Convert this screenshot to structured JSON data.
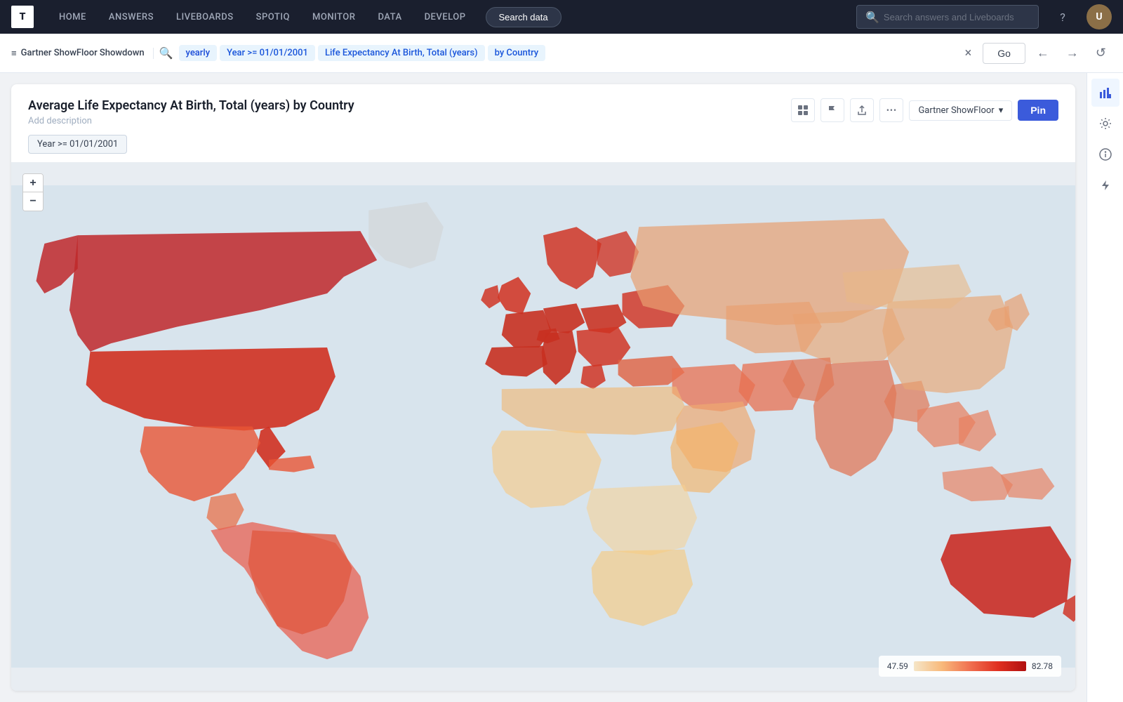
{
  "nav": {
    "logo_text": "T",
    "items": [
      {
        "label": "HOME",
        "id": "home"
      },
      {
        "label": "ANSWERS",
        "id": "answers"
      },
      {
        "label": "LIVEBOARDS",
        "id": "liveboards"
      },
      {
        "label": "SPOTIQ",
        "id": "spotiq"
      },
      {
        "label": "MONITOR",
        "id": "monitor"
      },
      {
        "label": "DATA",
        "id": "data"
      },
      {
        "label": "DEVELOP",
        "id": "develop"
      }
    ],
    "search_data_btn": "Search data",
    "search_placeholder": "Search answers and Liveboards"
  },
  "searchbar": {
    "source_name": "Gartner ShowFloor Showdown",
    "chips": [
      {
        "text": "yearly",
        "type": "time"
      },
      {
        "text": "Year >= 01/01/2001",
        "type": "filter"
      },
      {
        "text": "Life Expectancy At Birth, Total (years)",
        "type": "metric"
      },
      {
        "text": "by Country",
        "type": "dimension"
      }
    ],
    "go_label": "Go"
  },
  "chart": {
    "title": "Average Life Expectancy At Birth, Total (years) by Country",
    "subtitle": "Add description",
    "filter_label": "Year >= 01/01/2001",
    "liveboard_name": "Gartner ShowFloor",
    "pin_label": "Pin"
  },
  "legend": {
    "min_val": "47.59",
    "max_val": "82.78"
  },
  "icons": {
    "search": "🔍",
    "table": "⊞",
    "flag": "⚑",
    "share": "↑",
    "more": "•••",
    "chevron_down": "▾",
    "close": "×",
    "back": "←",
    "forward": "→",
    "refresh": "↺",
    "bar_chart": "▦",
    "gear": "⚙",
    "info": "ℹ",
    "lightning": "⚡",
    "zoom_in": "+",
    "zoom_out": "−",
    "hamburger": "≡"
  }
}
